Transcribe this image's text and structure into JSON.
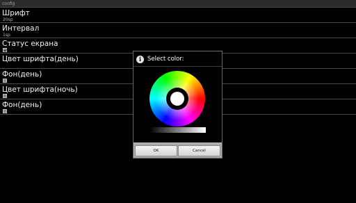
{
  "window": {
    "title": "config"
  },
  "prefs": [
    {
      "title": "Шрифт",
      "summary": "20sp"
    },
    {
      "title": "Интервал",
      "summary": "1sp"
    },
    {
      "title": "Статус екрана",
      "checked": true
    },
    {
      "title": "Цвет шрифта(день)"
    },
    {
      "title": "Фон(день)",
      "checked": false
    },
    {
      "title": "Цвет шрифта(ночь)",
      "checked": false
    },
    {
      "title": "Фон(день)",
      "checked": false
    }
  ],
  "dialog": {
    "title": "Select color:",
    "icon": "info-icon",
    "ok_label": "OK",
    "cancel_label": "Cancel"
  },
  "colors": {
    "background": "#000000",
    "divider": "#4a4a4a",
    "button_bar": "#a9a9a9"
  }
}
